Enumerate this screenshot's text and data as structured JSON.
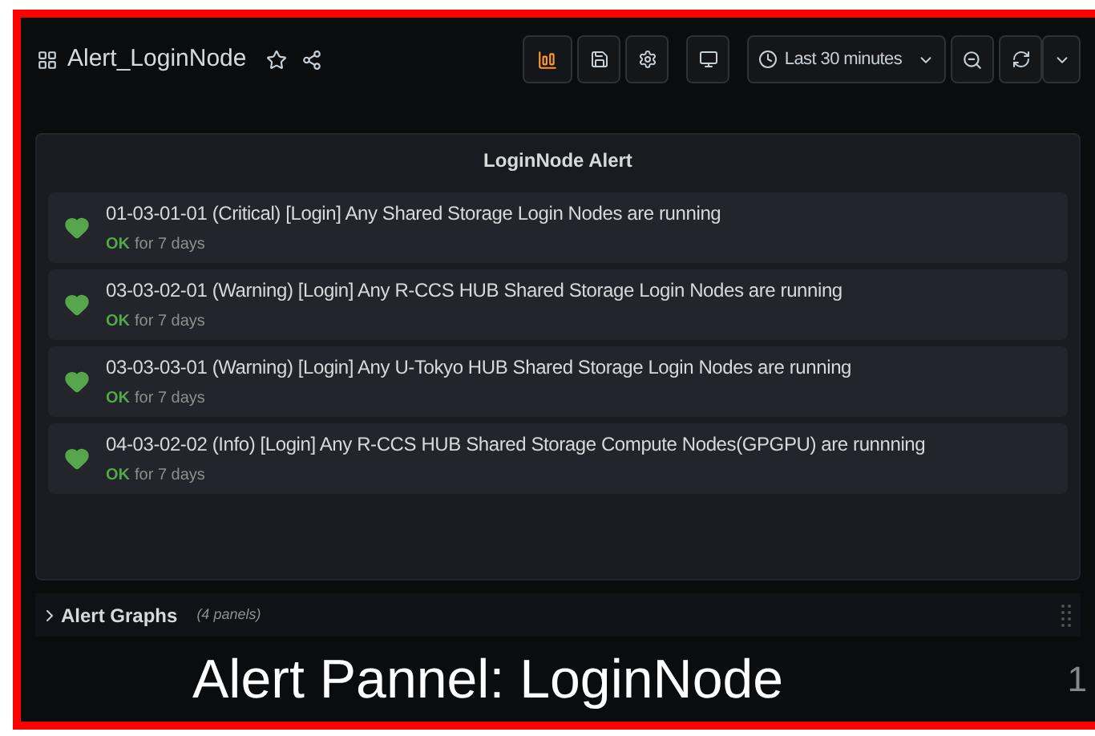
{
  "dashboard": {
    "title": "Alert_LoginNode",
    "time_range": "Last 30 minutes"
  },
  "panel": {
    "title": "LoginNode Alert",
    "alerts": [
      {
        "name": "01-03-01-01 (Critical) [Login] Any Shared Storage Login Nodes are running",
        "state": "OK",
        "duration": "for 7 days"
      },
      {
        "name": "03-03-02-01 (Warning) [Login] Any R-CCS HUB Shared Storage Login Nodes are running",
        "state": "OK",
        "duration": "for 7 days"
      },
      {
        "name": "03-03-03-01 (Warning) [Login] Any U-Tokyo HUB Shared Storage Login Nodes are running",
        "state": "OK",
        "duration": "for 7 days"
      },
      {
        "name": "04-03-02-02 (Info) [Login] Any R-CCS HUB Shared Storage Compute Nodes(GPGPU) are runnning",
        "state": "OK",
        "duration": "for 7 days"
      }
    ]
  },
  "row": {
    "title": "Alert Graphs",
    "count": "(4 panels)",
    "expanded": false
  },
  "caption": "Alert Pannel: LoginNode",
  "edge_text": "1"
}
